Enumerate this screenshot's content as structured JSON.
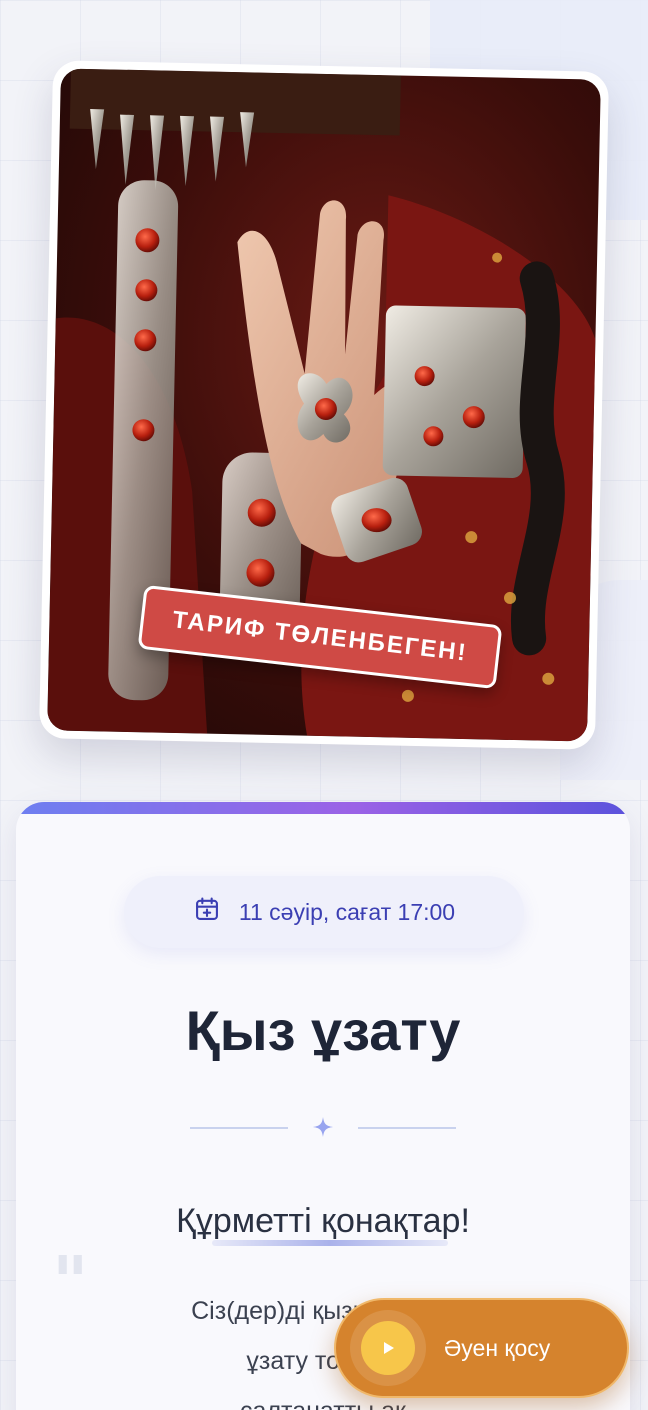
{
  "photo": {
    "alt": "Bride hand with traditional silver and carnelian jewelry",
    "badge": "ТАРИФ ТӨЛЕНБЕГЕН!"
  },
  "event": {
    "date": "11 сәуір, сағат 17:00",
    "title": "Қыз ұзату"
  },
  "invitation": {
    "greeting": "Құрметті қонақтар!",
    "quote_mark": "\"",
    "body_lines": [
      "Сіз(дер)ді қызымыз Ай",
      "ұзату тойына",
      "салтанатты ақ"
    ]
  },
  "music": {
    "label": "Әуен қосу"
  },
  "colors": {
    "accent": "#3b3fb3",
    "badge": "#cf4a45",
    "music_button": "#d5832d",
    "play": "#f7c64a"
  },
  "icons": {
    "date": "calendar-plus-icon",
    "divider": "sparkle-icon",
    "play": "play-icon"
  }
}
